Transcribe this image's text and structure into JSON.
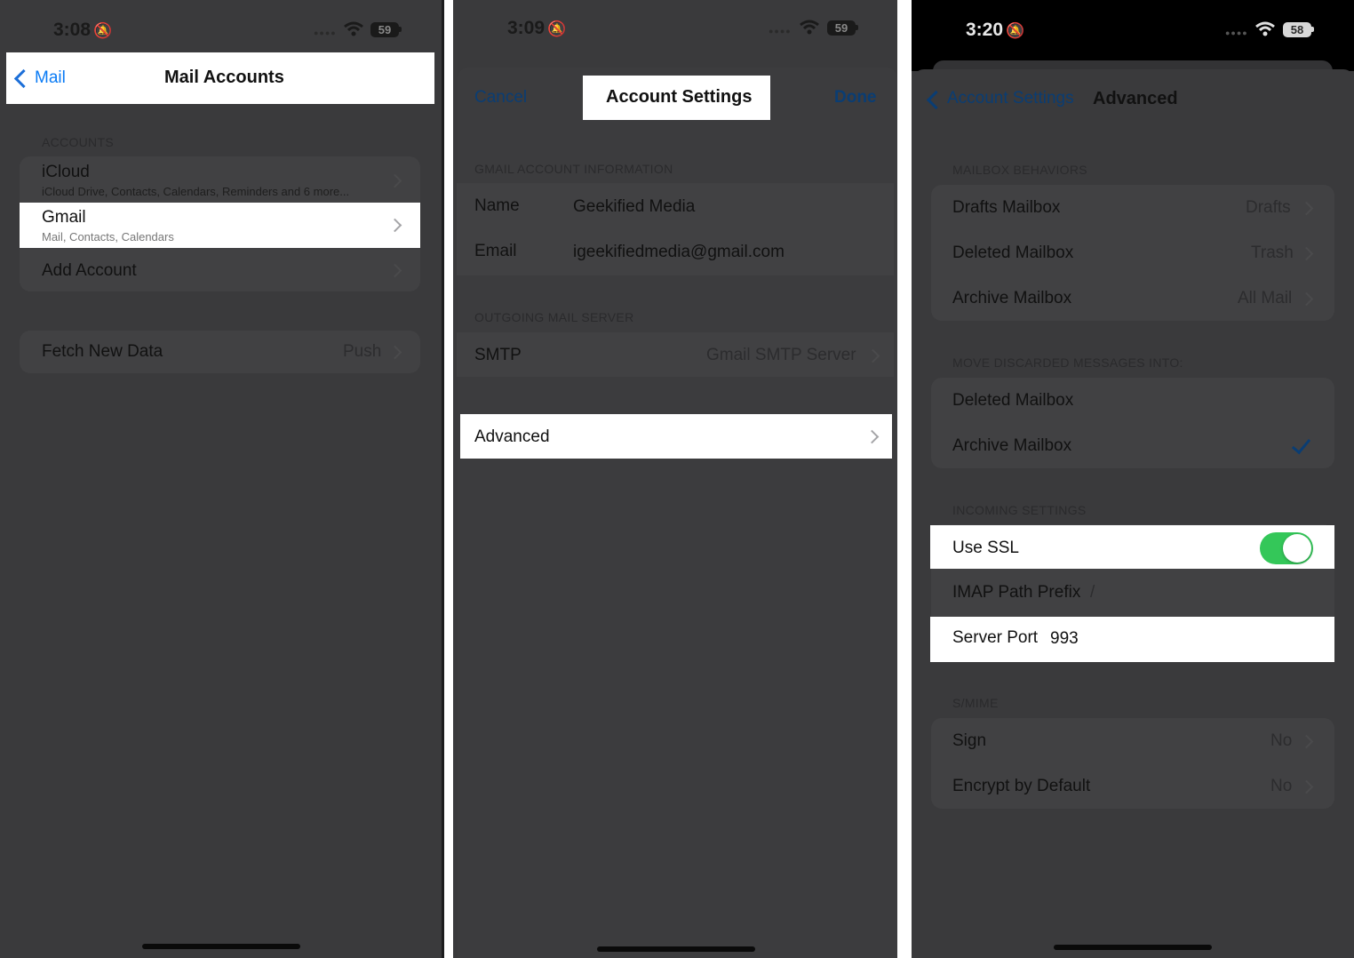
{
  "phone1": {
    "status": {
      "time": "3:08",
      "battery": "59"
    },
    "nav": {
      "back_label": "Mail",
      "title": "Mail Accounts"
    },
    "accounts_header": "ACCOUNTS",
    "rows": [
      {
        "label": "iCloud",
        "sub": "iCloud Drive, Contacts, Calendars, Reminders and 6 more..."
      },
      {
        "label": "Gmail",
        "sub": "Mail, Contacts, Calendars"
      },
      {
        "label": "Add Account"
      }
    ],
    "fetch": {
      "label": "Fetch New Data",
      "value": "Push"
    }
  },
  "phone2": {
    "status": {
      "time": "3:09",
      "battery": "59"
    },
    "nav": {
      "cancel_label": "Cancel",
      "title": "Account Settings",
      "done_label": "Done"
    },
    "gmail_header": "GMAIL ACCOUNT INFORMATION",
    "name": {
      "label": "Name",
      "value": "Geekified Media"
    },
    "email": {
      "label": "Email",
      "value": "igeekifiedmedia@gmail.com"
    },
    "outgoing_header": "OUTGOING MAIL SERVER",
    "smtp": {
      "label": "SMTP",
      "value": "Gmail SMTP Server"
    },
    "advanced_label": "Advanced"
  },
  "phone3": {
    "status": {
      "time": "3:20",
      "battery": "58"
    },
    "nav": {
      "back_label": "Account Settings",
      "title": "Advanced"
    },
    "mailbox_header": "MAILBOX BEHAVIORS",
    "mailbox_rows": [
      {
        "label": "Drafts Mailbox",
        "value": "Drafts"
      },
      {
        "label": "Deleted Mailbox",
        "value": "Trash"
      },
      {
        "label": "Archive Mailbox",
        "value": "All Mail"
      }
    ],
    "discard_header": "MOVE DISCARDED MESSAGES INTO:",
    "discard_rows": [
      {
        "label": "Deleted Mailbox"
      },
      {
        "label": "Archive Mailbox",
        "checked": true
      }
    ],
    "incoming_header": "INCOMING SETTINGS",
    "use_ssl": {
      "label": "Use SSL",
      "on": true
    },
    "imap": {
      "label": "IMAP Path Prefix",
      "value": "/"
    },
    "port": {
      "label": "Server Port",
      "value": "993"
    },
    "smime_header": "S/MIME",
    "smime_rows": [
      {
        "label": "Sign",
        "value": "No"
      },
      {
        "label": "Encrypt by Default",
        "value": "No"
      }
    ]
  },
  "colors": {
    "accent": "#0a7bf5",
    "toggle_on": "#34c759",
    "dim_overlay": "#3a3a3c"
  }
}
